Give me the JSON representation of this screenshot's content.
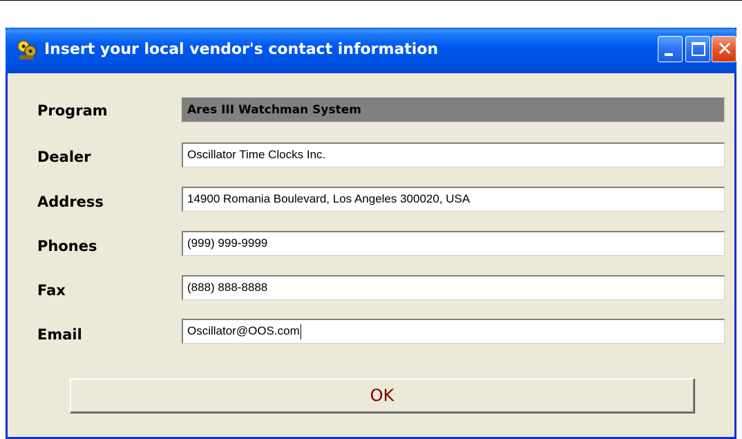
{
  "window": {
    "title": "Insert your local vendor's contact information",
    "close_glyph": "✕"
  },
  "form": {
    "program": {
      "label": "Program",
      "value": "Ares III Watchman System"
    },
    "dealer": {
      "label": "Dealer",
      "value": "Oscillator Time Clocks Inc."
    },
    "address": {
      "label": "Address",
      "value": "14900 Romania Boulevard, Los Angeles 300020, USA"
    },
    "phones": {
      "label": "Phones",
      "value": "(999) 999-9999"
    },
    "fax": {
      "label": "Fax",
      "value": "(888) 888-8888"
    },
    "email": {
      "label": "Email",
      "value": "Oscillator@OOS.com"
    }
  },
  "buttons": {
    "ok_label": "OK"
  },
  "icons": {
    "app": "app-icon",
    "minimize": "minimize-icon",
    "maximize": "maximize-icon",
    "close": "close-icon"
  },
  "colors": {
    "titlebar": "#0054E3",
    "window_bg": "#ECE9D8",
    "readonly_field": "#808080",
    "ok_text": "#800000",
    "close_button": "#E5572E"
  }
}
